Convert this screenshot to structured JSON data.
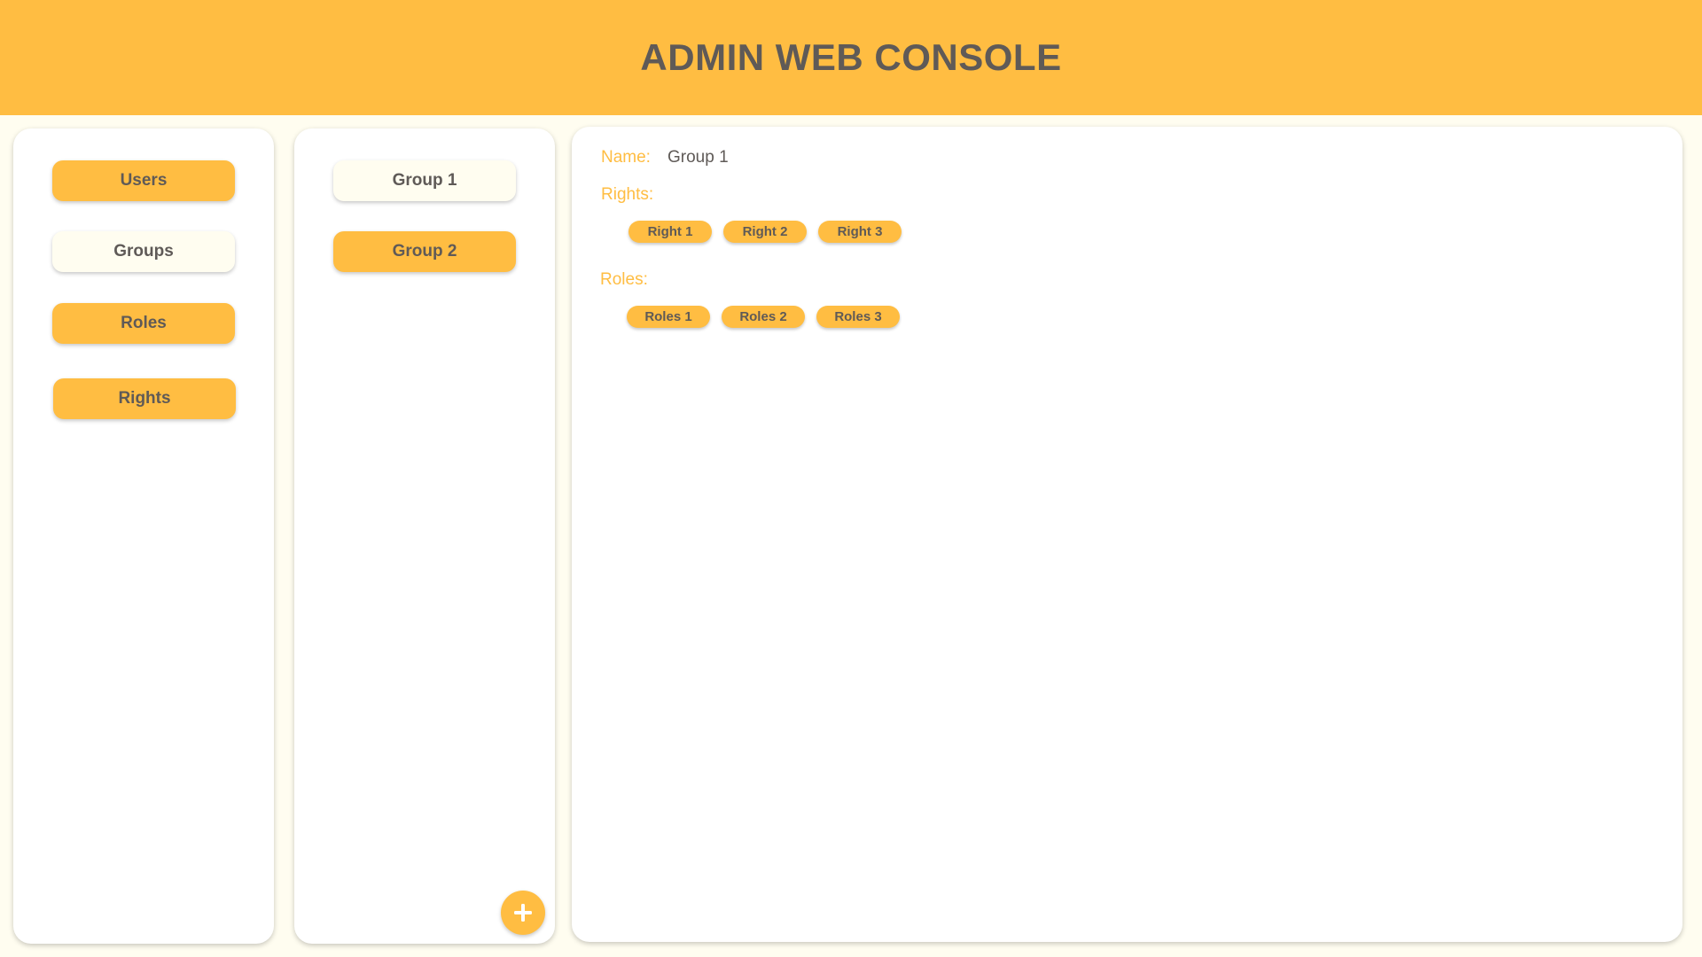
{
  "header": {
    "title": "ADMIN WEB CONSOLE"
  },
  "nav": {
    "items": [
      {
        "label": "Users",
        "active": false
      },
      {
        "label": "Groups",
        "active": true
      },
      {
        "label": "Roles",
        "active": false
      },
      {
        "label": "Rights",
        "active": false
      }
    ]
  },
  "groups": {
    "items": [
      {
        "label": "Group 1",
        "active": true
      },
      {
        "label": "Group 2",
        "active": false
      }
    ],
    "add_icon": "plus-icon"
  },
  "detail": {
    "name_label": "Name:",
    "name_value": "Group 1",
    "rights_label": "Rights:",
    "rights": [
      "Right 1",
      "Right 2",
      "Right 3"
    ],
    "roles_label": "Roles:",
    "roles": [
      "Roles 1",
      "Roles 2",
      "Roles 3"
    ]
  },
  "colors": {
    "accent": "#ffbd42",
    "background": "#fffdf0",
    "text": "#5f5a57",
    "panel": "#ffffff"
  }
}
